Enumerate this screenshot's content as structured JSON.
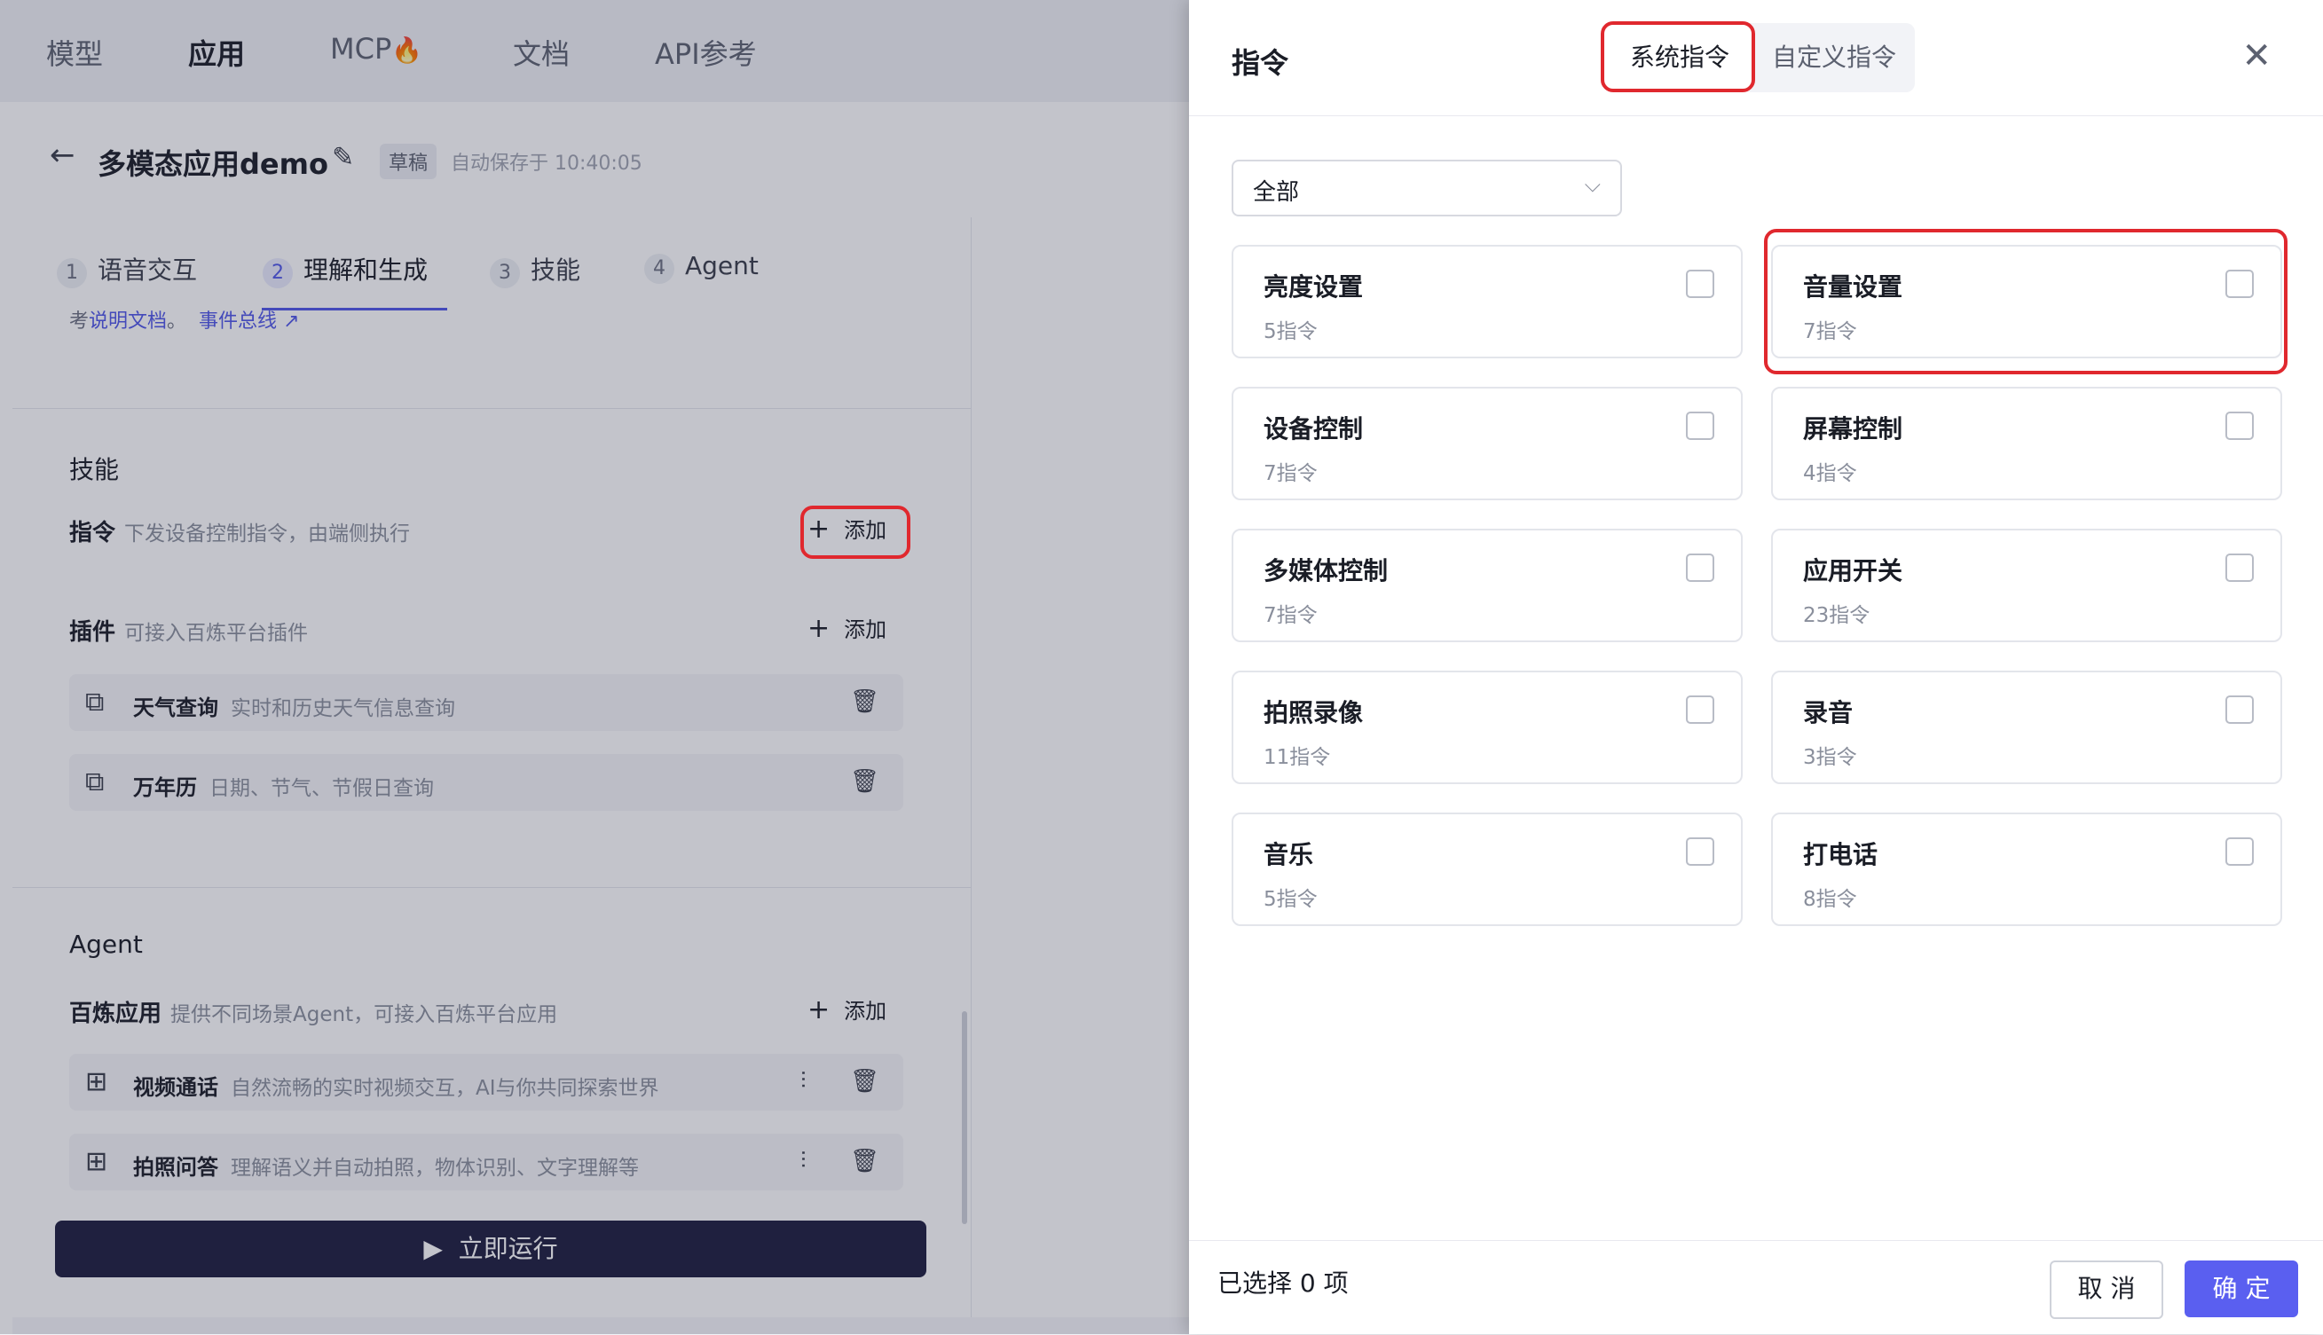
{
  "nav": {
    "items": [
      "模型",
      "应用",
      "MCP",
      "文档",
      "API参考"
    ],
    "active_index": 1,
    "fire_glyph": "🔥"
  },
  "project": {
    "title": "多模态应用demo",
    "badge": "草稿",
    "autosave": "自动保存于 10:40:05"
  },
  "steps": [
    {
      "num": "1",
      "label": "语音交互"
    },
    {
      "num": "2",
      "label": "理解和生成"
    },
    {
      "num": "3",
      "label": "技能"
    },
    {
      "num": "4",
      "label": "Agent"
    }
  ],
  "active_step_index": 1,
  "ref": {
    "prefix": "考",
    "doc_link": "说明文档",
    "sep": "。",
    "event_link": "事件总线",
    "arrow": "↗"
  },
  "skills": {
    "title": "技能",
    "command": {
      "label": "指令",
      "desc": "下发设备控制指令，由端侧执行",
      "add": "添加"
    },
    "plugin": {
      "label": "插件",
      "desc": "可接入百炼平台插件",
      "add": "添加"
    },
    "plugins": [
      {
        "name": "天气查询",
        "desc": "实时和历史天气信息查询"
      },
      {
        "name": "万年历",
        "desc": "日期、节气、节假日查询"
      }
    ]
  },
  "agent": {
    "title": "Agent",
    "app": {
      "label": "百炼应用",
      "desc": "提供不同场景Agent，可接入百炼平台应用",
      "add": "添加"
    },
    "apps": [
      {
        "name": "视频通话",
        "desc": "自然流畅的实时视频交互，AI与你共同探索世界"
      },
      {
        "name": "拍照问答",
        "desc": "理解语义并自动拍照，物体识别、文字理解等"
      }
    ]
  },
  "run_button": "立即运行",
  "dialog": {
    "title": "指令",
    "tabs": [
      "系统指令",
      "自定义指令"
    ],
    "active_tab": 0,
    "filter_value": "全部",
    "commands": [
      {
        "name": "亮度设置",
        "count": "5指令",
        "checked": false
      },
      {
        "name": "音量设置",
        "count": "7指令",
        "checked": false
      },
      {
        "name": "设备控制",
        "count": "7指令",
        "checked": false
      },
      {
        "name": "屏幕控制",
        "count": "4指令",
        "checked": false
      },
      {
        "name": "多媒体控制",
        "count": "7指令",
        "checked": false
      },
      {
        "name": "应用开关",
        "count": "23指令",
        "checked": false
      },
      {
        "name": "拍照录像",
        "count": "11指令",
        "checked": false
      },
      {
        "name": "录音",
        "count": "3指令",
        "checked": false
      },
      {
        "name": "音乐",
        "count": "5指令",
        "checked": false
      },
      {
        "name": "打电话",
        "count": "8指令",
        "checked": false
      }
    ],
    "selected_text": "已选择 0 项",
    "cancel": "取 消",
    "confirm": "确 定"
  },
  "colors": {
    "accent": "#5a5ff0",
    "highlight_ring": "#e0282e",
    "run_button": "#1c1d3e"
  }
}
